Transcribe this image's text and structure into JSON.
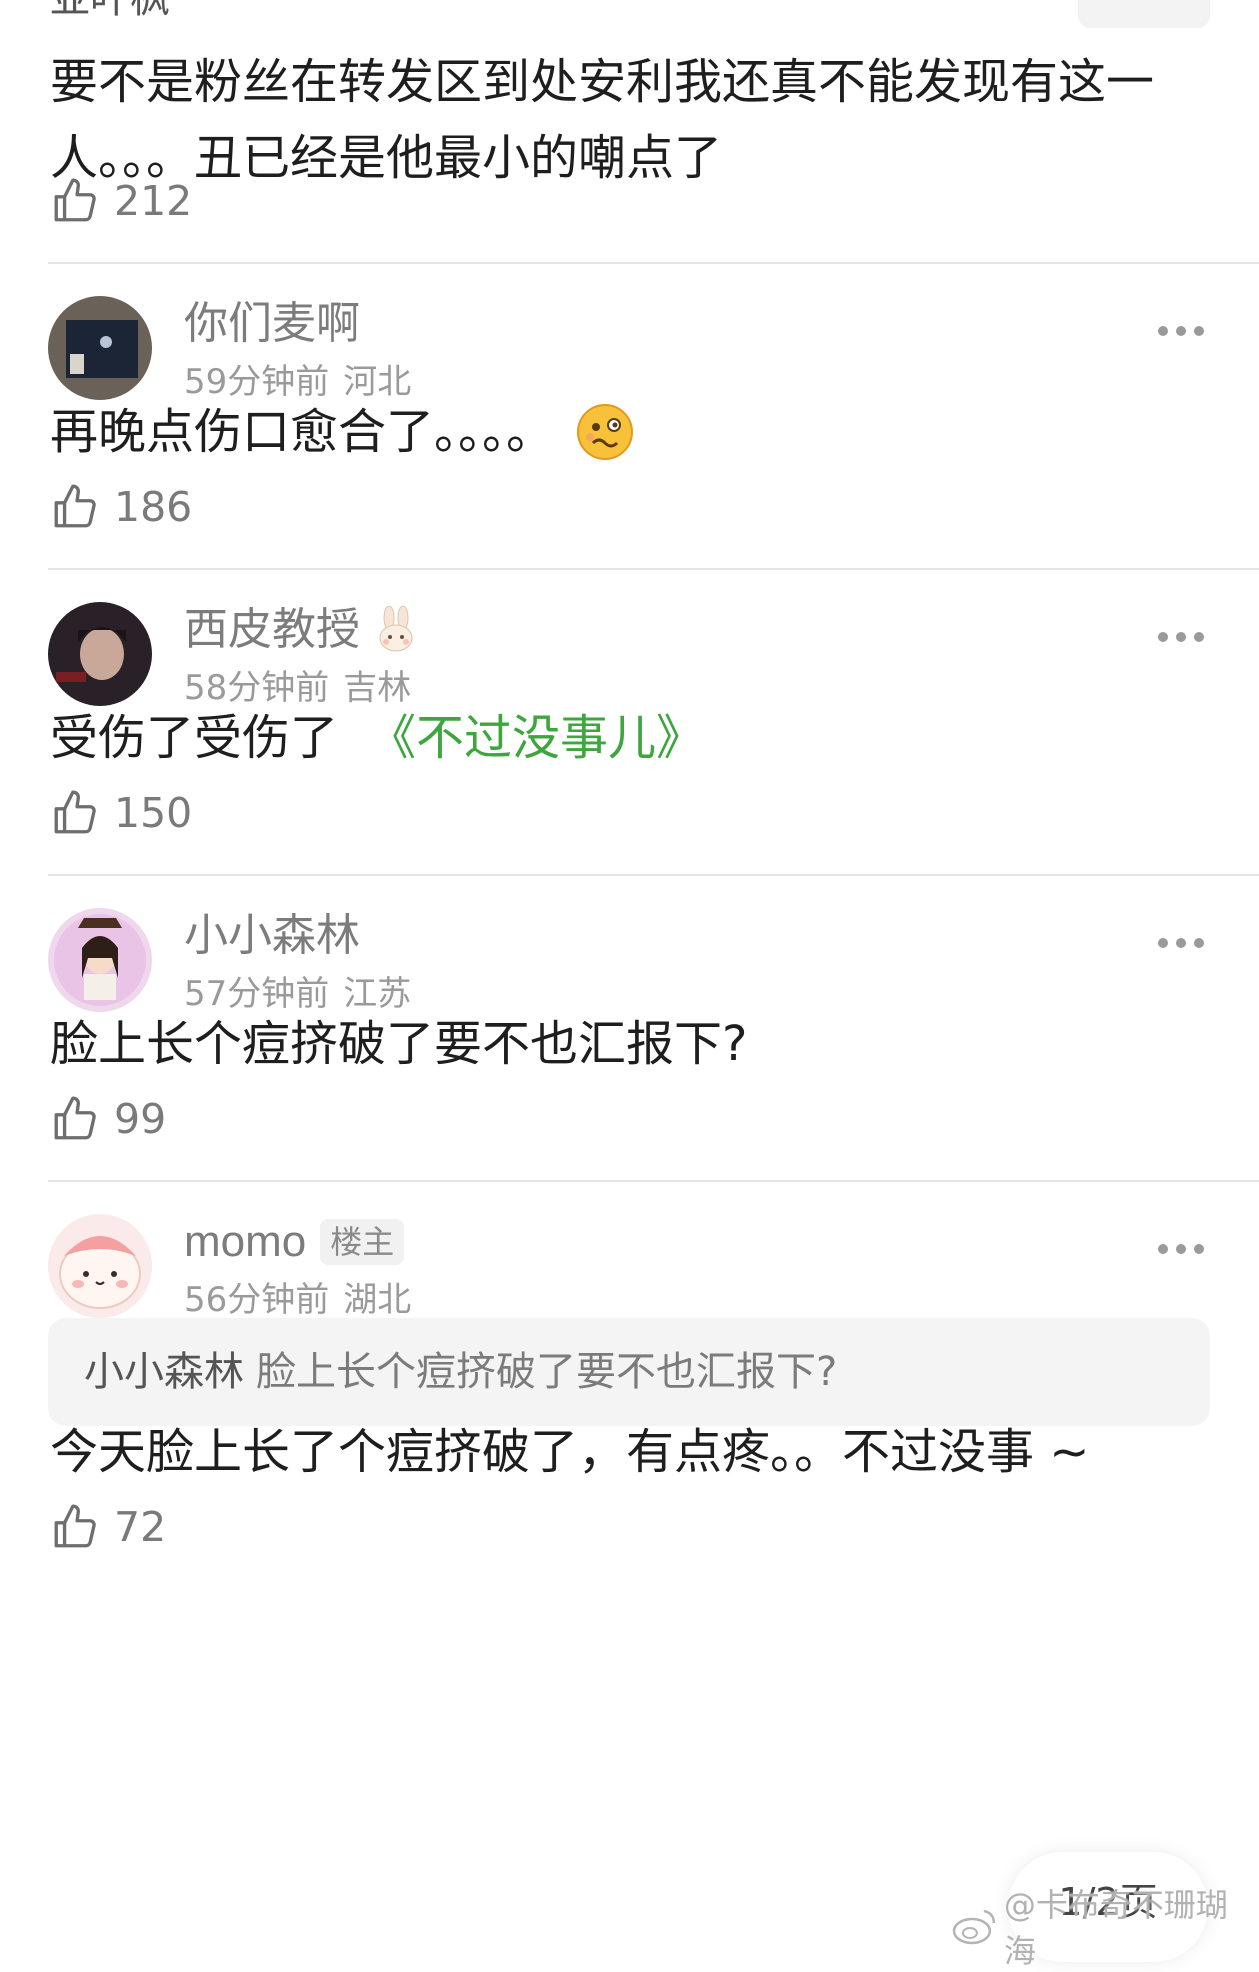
{
  "top": {
    "cut_username": "亚叶枫",
    "text": "要不是粉丝在转发区到处安利我还真不能发现有这一人。。。丑已经是他最小的嘲点了",
    "likes": "212"
  },
  "comments": [
    {
      "username": "你们麦啊",
      "time": "59分钟前",
      "location": "河北",
      "text": "再晚点伤口愈合了。。。。",
      "emoji": "woozy-face",
      "likes": "186"
    },
    {
      "username": "西皮教授",
      "time": "58分钟前",
      "location": "吉林",
      "text": "受伤了受伤了",
      "topic": "《不过没事儿》",
      "likes": "150"
    },
    {
      "username": "小小森林",
      "time": "57分钟前",
      "location": "江苏",
      "text": "脸上长个痘挤破了要不也汇报下?",
      "likes": "99"
    },
    {
      "username": "momo",
      "badge": "楼主",
      "time": "56分钟前",
      "location": "湖北",
      "quote_name": "小小森林",
      "quote_text": "脸上长个痘挤破了要不也汇报下?",
      "text": "今天脸上长了个痘挤破了，有点疼。。不过没事 ~",
      "likes": "72"
    }
  ],
  "pager": "1/2页",
  "watermark": "@卡布奇不珊瑚海",
  "colors": {
    "topic": "#3fa63f",
    "text": "#1e1e1e",
    "meta": "#9a9a9a"
  }
}
